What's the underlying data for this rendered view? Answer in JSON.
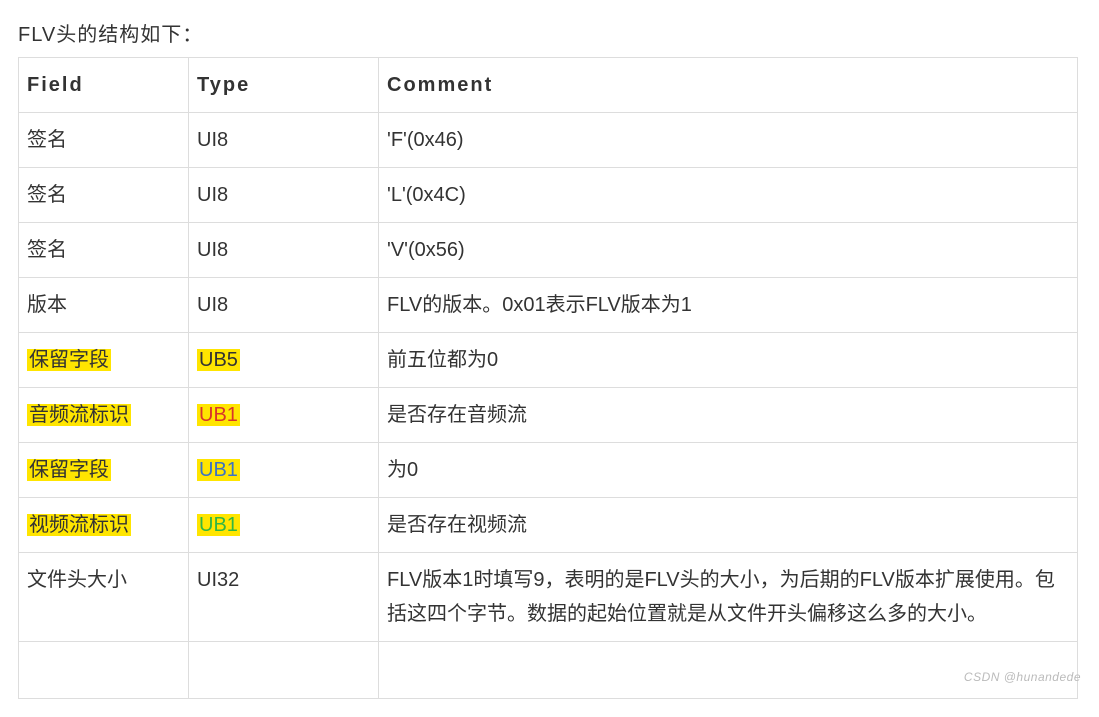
{
  "title": "FLV头的结构如下：",
  "headers": {
    "field": "Field",
    "type": "Type",
    "comment": "Comment"
  },
  "rows": [
    {
      "field": "签名",
      "type": "UI8",
      "comment": "'F'(0x46)"
    },
    {
      "field": "签名",
      "type": "UI8",
      "comment": "'L'(0x4C)"
    },
    {
      "field": "签名",
      "type": "UI8",
      "comment": "'V'(0x56)"
    },
    {
      "field": "版本",
      "type": "UI8",
      "comment": "FLV的版本。0x01表示FLV版本为1"
    },
    {
      "field": "保留字段",
      "field_hl": true,
      "type": "UB5",
      "type_hl": true,
      "type_color": "",
      "comment": "前五位都为0"
    },
    {
      "field": "音频流标识",
      "field_hl": true,
      "type": "UB1",
      "type_hl": true,
      "type_color": "clr-red",
      "comment": "是否存在音频流"
    },
    {
      "field": "保留字段",
      "field_hl": true,
      "type": "UB1",
      "type_hl": true,
      "type_color": "clr-blue",
      "comment": "为0"
    },
    {
      "field": "视频流标识",
      "field_hl": true,
      "type": "UB1",
      "type_hl": true,
      "type_color": "clr-green",
      "comment": "是否存在视频流"
    },
    {
      "field": "文件头大小",
      "type": "UI32",
      "comment": "FLV版本1时填写9，表明的是FLV头的大小，为后期的FLV版本扩展使用。包括这四个字节。数据的起始位置就是从文件开头偏移这么多的大小。"
    }
  ],
  "watermark": "CSDN @hunandede"
}
